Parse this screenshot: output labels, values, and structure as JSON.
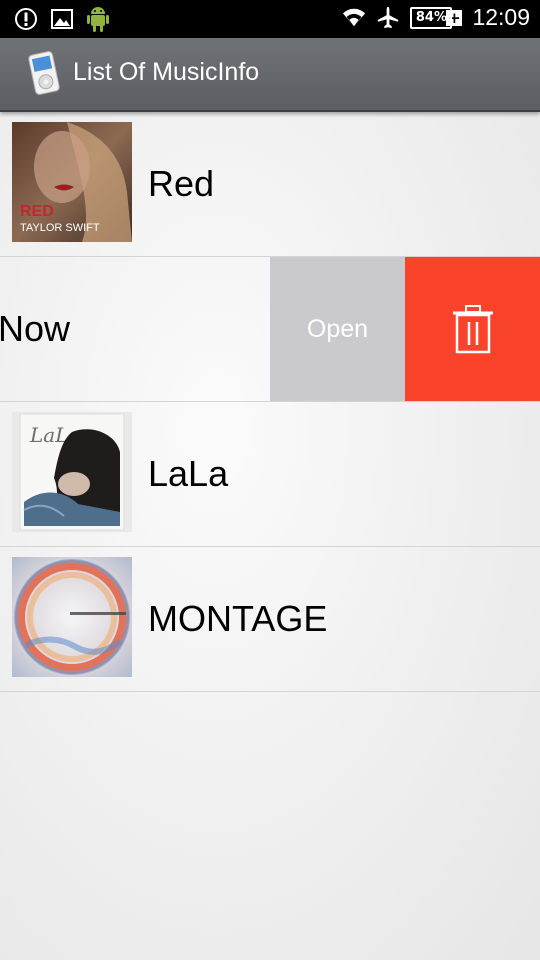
{
  "status_bar": {
    "battery_level": "84%",
    "time": "12:09",
    "icons": [
      "alert-icon",
      "image-icon",
      "android-icon",
      "wifi-icon",
      "airplane-icon",
      "battery-icon"
    ]
  },
  "action_bar": {
    "title": "List Of MusicInfo",
    "icon": "music-player-icon"
  },
  "music_list": [
    {
      "title": "Red",
      "art_text": [
        "RED",
        "TAYLOR SWIFT"
      ]
    },
    {
      "title": "Now",
      "swiped": true,
      "actions": {
        "open_label": "Open",
        "delete_icon": "trash-icon"
      }
    },
    {
      "title": "LaLa",
      "art_text": [
        "LaLa"
      ]
    },
    {
      "title": "MONTAGE"
    }
  ],
  "colors": {
    "action_bar": "#626669",
    "open_button": "#c9c9ce",
    "delete_button": "#f9432b"
  }
}
